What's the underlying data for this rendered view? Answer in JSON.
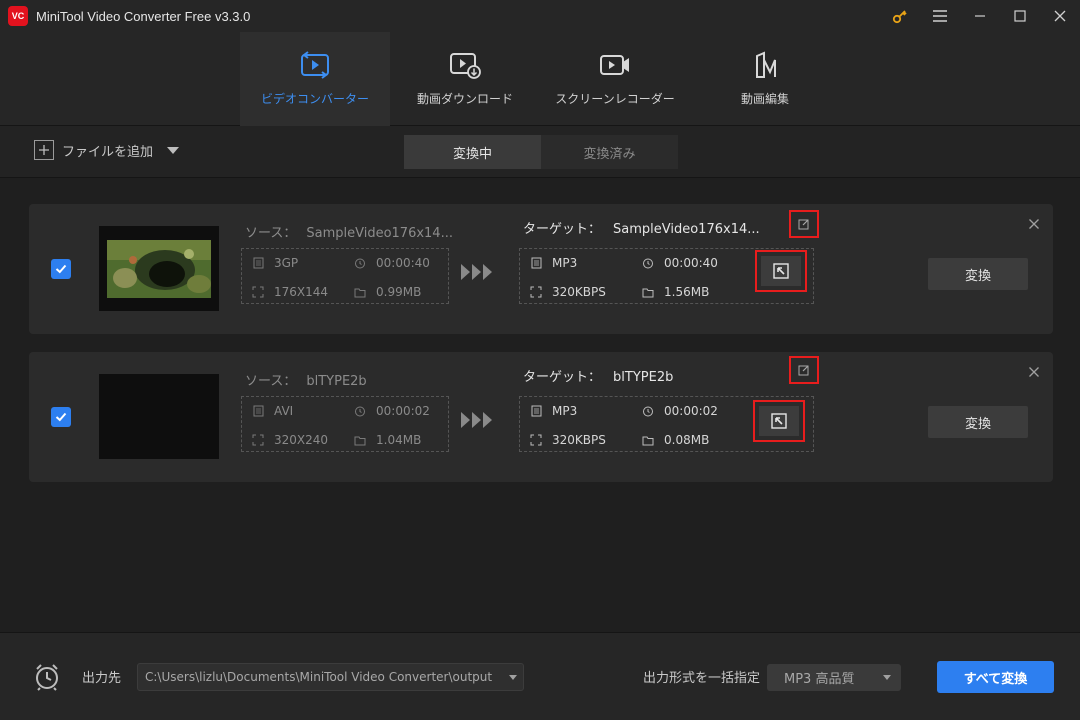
{
  "window": {
    "logo_text": "VC",
    "title": "MiniTool Video Converter Free v3.3.0",
    "controls": [
      "key-icon",
      "menu-icon",
      "minimize-icon",
      "maximize-icon",
      "close-icon"
    ]
  },
  "nav": {
    "tabs": [
      {
        "label": "ビデオコンバーター",
        "icon": "convert-icon",
        "active": true
      },
      {
        "label": "動画ダウンロード",
        "icon": "download-video-icon",
        "active": false
      },
      {
        "label": "スクリーンレコーダー",
        "icon": "screen-record-icon",
        "active": false
      },
      {
        "label": "動画編集",
        "icon": "video-edit-icon",
        "active": false
      }
    ]
  },
  "toolbar": {
    "add_file_label": "ファイルを追加",
    "segments": [
      "変換中",
      "変換済み"
    ],
    "active_segment": "変換中"
  },
  "items": [
    {
      "source_label": "ソース：",
      "source_name": "SampleVideo176x14...",
      "source_format": "3GP",
      "source_duration": "00:00:40",
      "source_resolution": "176X144",
      "source_size": "0.99MB",
      "target_label": "ターゲット：",
      "target_name": "SampleVideo176x14...",
      "target_format": "MP3",
      "target_duration": "00:00:40",
      "target_bitrate": "320KBPS",
      "target_size": "1.56MB",
      "convert_label": "変換",
      "checked": true
    },
    {
      "source_label": "ソース：",
      "source_name": "blTYPE2b",
      "source_format": "AVI",
      "source_duration": "00:00:02",
      "source_resolution": "320X240",
      "source_size": "1.04MB",
      "target_label": "ターゲット：",
      "target_name": "blTYPE2b",
      "target_format": "MP3",
      "target_duration": "00:00:02",
      "target_bitrate": "320KBPS",
      "target_size": "0.08MB",
      "convert_label": "変換",
      "checked": true
    }
  ],
  "bottom": {
    "output_label": "出力先",
    "output_path": "C:\\Users\\lizlu\\Documents\\MiniTool Video Converter\\output",
    "format_label": "出力形式を一括指定",
    "format_value": "MP3 高品質",
    "convert_all_label": "すべて変換"
  },
  "colors": {
    "accent": "#2d7ff0",
    "active_tab_text": "#3d8ef0",
    "highlight_box": "#e81d1d"
  }
}
